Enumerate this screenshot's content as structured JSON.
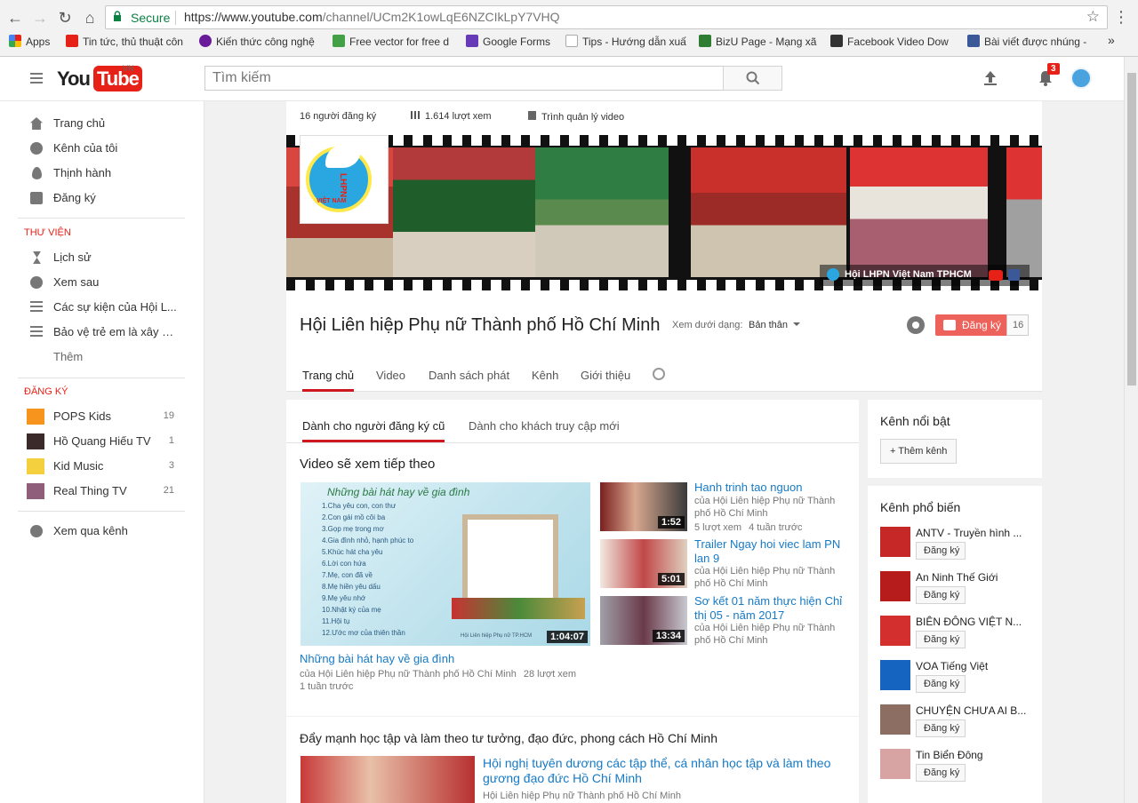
{
  "browser": {
    "secure_label": "Secure",
    "url_host": "https://www.youtube.com",
    "url_path": "/channel/UCm2K1owLqE6NZCIkLpY7VHQ",
    "bookmarks": [
      {
        "label": "Apps",
        "color": "#e62117"
      },
      {
        "label": "Tin tức, thủ thuật côn",
        "color": "#e62117"
      },
      {
        "label": "Kiến thức công nghệ",
        "color": "#6a1b9a"
      },
      {
        "label": "Free vector for free d",
        "color": "#43a047"
      },
      {
        "label": "Google Forms",
        "color": "#673ab7"
      },
      {
        "label": "Tips - Hướng dẫn xuấ",
        "color": "#9e9e9e"
      },
      {
        "label": "BizU Page - Mạng xã",
        "color": "#2e7d32"
      },
      {
        "label": "Facebook Video Dow",
        "color": "#333333"
      },
      {
        "label": "Bài viết được nhúng -",
        "color": "#3b5998"
      }
    ],
    "more": "»"
  },
  "youtube": {
    "logo_you": "You",
    "logo_tube": "Tube",
    "logo_region": "VN",
    "search_placeholder": "Tìm kiếm",
    "notification_count": "3"
  },
  "sidebar": {
    "main": [
      {
        "label": "Trang chủ"
      },
      {
        "label": "Kênh của tôi"
      },
      {
        "label": "Thịnh hành"
      },
      {
        "label": "Đăng ký"
      }
    ],
    "library_heading": "THƯ VIỆN",
    "library": [
      {
        "label": "Lịch sử"
      },
      {
        "label": "Xem sau"
      },
      {
        "label": "Các sự kiện của Hội L..."
      },
      {
        "label": "Bảo vệ trẻ em là xây d..."
      },
      {
        "label": "Thêm"
      }
    ],
    "subs_heading": "ĐĂNG KÝ",
    "subs": [
      {
        "label": "POPS Kids",
        "count": "19"
      },
      {
        "label": "Hồ Quang Hiếu TV",
        "count": "1"
      },
      {
        "label": "Kid Music",
        "count": "3"
      },
      {
        "label": "Real Thing TV",
        "count": "21"
      }
    ],
    "browse": "Xem qua kênh"
  },
  "channel": {
    "subscribers": "16 người đăng ký",
    "views": "1.614 lượt xem",
    "manager": "Trình quản lý video",
    "banner_link": "Hội LHPN Việt Nam TPHCM",
    "logo_text": "LHPN",
    "logo_subtext": "VIỆT NAM",
    "name": "Hội Liên hiệp Phụ nữ Thành phố Hồ Chí Minh",
    "view_as_label": "Xem dưới dạng:",
    "view_as_value": "Bản thân",
    "subscribe_label": "Đăng ký",
    "subscribe_count": "16",
    "tabs": [
      "Trang chủ",
      "Video",
      "Danh sách phát",
      "Kênh",
      "Giới thiệu"
    ]
  },
  "content": {
    "subtabs": [
      "Dành cho người đăng ký cũ",
      "Dành cho khách truy cập mới"
    ],
    "section_title": "Video sẽ xem tiếp theo",
    "featured": {
      "title": "Những bài hát hay về gia đình",
      "channel": "của Hội Liên hiệp Phụ nữ Thành phố Hồ Chí Minh",
      "views": "28 lượt xem",
      "age": "1 tuần trước",
      "duration": "1:04:07",
      "thumb_heading": "Những bài hát hay về gia đình",
      "thumb_lines": [
        "1.Cha yêu con, con thư",
        "2.Con gái mồ côi ba",
        "3.Gọp mẹ trong mơ",
        "4.Gia đình nhỏ, hạnh phúc to",
        "5.Khúc hát cha yêu",
        "6.Lời con hứa",
        "7.Mẹ, con đã về",
        "8.Mẹ hiền yêu dấu",
        "9.Mẹ yêu nhớ",
        "10.Nhật ký của mẹ",
        "11.Hội tụ",
        "12.Ước mơ của thiên thần"
      ],
      "thumb_footer": "Hội Liên hiệp Phụ nữ TP.HCM"
    },
    "side_videos": [
      {
        "title": "Hanh trinh tao nguon",
        "channel": "của Hội Liên hiệp Phụ nữ Thành phố Hồ Chí Minh",
        "views": "5 lượt xem",
        "age": "4 tuần trước",
        "duration": "1:52"
      },
      {
        "title": "Trailer Ngay hoi viec lam PN lan 9",
        "channel": "của Hội Liên hiệp Phụ nữ Thành phố Hồ Chí Minh",
        "duration": "5:01"
      },
      {
        "title": "Sơ kết 01 năm thực hiện Chỉ thị 05 - năm 2017",
        "channel": "của Hội Liên hiệp Phụ nữ Thành phố Hồ Chí Minh",
        "duration": "13:34"
      }
    ],
    "section2_title": "Đẩy mạnh học tập và làm theo tư tưởng, đạo đức, phong cách Hồ Chí Minh",
    "section2_video": {
      "title": "Hội nghị tuyên dương các tập thể, cá nhân học tập và làm theo gương đạo đức Hồ Chí Minh",
      "channel": "Hội Liên hiệp Phụ nữ Thành phố Hồ Chí Minh"
    }
  },
  "right": {
    "featured_heading": "Kênh nổi bật",
    "add_channel": "+ Thêm kênh",
    "popular_heading": "Kênh phổ biến",
    "subscribe_label": "Đăng ký",
    "popular": [
      {
        "name": "ANTV - Truyền hình ...",
        "color": "#c62828"
      },
      {
        "name": "An Ninh Thế Giới",
        "color": "#b71c1c"
      },
      {
        "name": "BIÊN ĐÔNG VIỆT N...",
        "color": "#d32f2f"
      },
      {
        "name": "VOA Tiếng Việt",
        "color": "#1565c0"
      },
      {
        "name": "CHUYỆN CHƯA AI B...",
        "color": "#8d6e63"
      },
      {
        "name": "Tin Biển Đông",
        "color": "#d7a3a3"
      }
    ]
  }
}
